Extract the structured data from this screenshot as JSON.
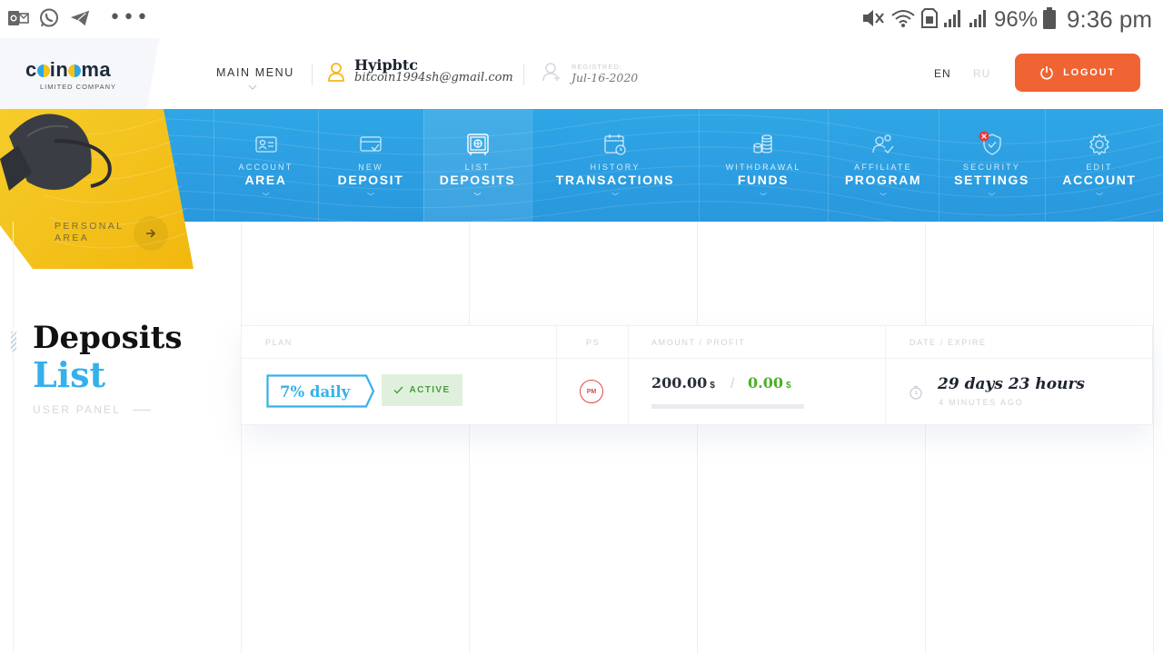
{
  "status_bar": {
    "battery_percent": "96%",
    "time": "9:36 pm",
    "more_glyph": "•••",
    "left_icons": [
      "outlook-icon",
      "whatsapp-icon",
      "telegram-icon"
    ],
    "right_icons": [
      "mute-icon",
      "wifi-icon",
      "sim-icon",
      "signal-icon",
      "signal-icon",
      "battery-icon"
    ]
  },
  "header": {
    "logo": {
      "word": "c●in●ma",
      "subtitle": "LIMITED COMPANY"
    },
    "main_menu": "MAIN MENU",
    "user": {
      "name": "Hyipbtc",
      "email": "bitcoin1994sh@gmail.com"
    },
    "registered": {
      "label": "REGISTRED:",
      "date": "Jul-16-2020"
    },
    "lang_en": "EN",
    "lang_ru": "RU",
    "logout": "LOGOUT"
  },
  "nav": [
    {
      "top": "ACCOUNT",
      "bottom": "AREA",
      "icon": "id-card-icon"
    },
    {
      "top": "NEW",
      "bottom": "DEPOSIT",
      "icon": "wallet-icon"
    },
    {
      "top": "LIST",
      "bottom": "DEPOSITS",
      "icon": "safe-icon",
      "active": true
    },
    {
      "top": "HISTORY",
      "bottom": "TRANSACTIONS",
      "icon": "calendar-icon"
    },
    {
      "top": "WITHDRAWAL",
      "bottom": "FUNDS",
      "icon": "coins-icon"
    },
    {
      "top": "AFFILIATE",
      "bottom": "PROGRAM",
      "icon": "users-icon"
    },
    {
      "top": "SECURITY",
      "bottom": "SETTINGS",
      "icon": "shield-check-icon",
      "alert": true
    },
    {
      "top": "EDIT",
      "bottom": "ACCOUNT",
      "icon": "gear-icon"
    }
  ],
  "personal_area": {
    "line1": "PERSONAL",
    "line2": "AREA"
  },
  "page": {
    "title_1": "Deposits",
    "title_2": "List",
    "subtitle": "USER PANEL"
  },
  "table": {
    "headers": {
      "plan": "PLAN",
      "ps": "PS",
      "amount": "AMOUNT / PROFIT",
      "date": "DATE / EXPIRE"
    },
    "rows": [
      {
        "plan": "7% daily",
        "status": "ACTIVE",
        "ps": "PM",
        "amount": "200.00",
        "amount_currency": "$",
        "profit": "0.00",
        "profit_currency": "$",
        "progress": 0,
        "expire": "29 days 23 hours",
        "ago": "4 MINUTES AGO"
      }
    ]
  },
  "colors": {
    "accent_blue": "#35b1ea",
    "nav_blue": "#2998dd",
    "logout_orange": "#f06433",
    "profit_green": "#4caf28",
    "panel_yellow": "#f3c21b"
  }
}
